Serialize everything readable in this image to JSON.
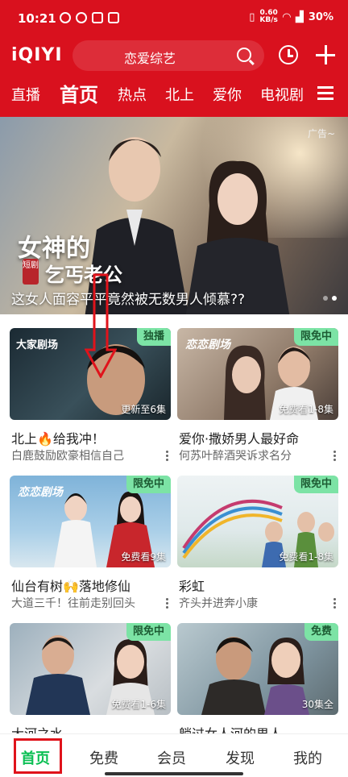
{
  "status_bar": {
    "time": "10:21",
    "net_speed_top": "0.60",
    "net_speed_unit": "KB/s",
    "battery": "30%"
  },
  "header": {
    "logo": "iQIYI",
    "search_text": "恋爱综艺"
  },
  "tabs": [
    "直播",
    "首页",
    "热点",
    "北上",
    "爱你",
    "电视剧"
  ],
  "active_tab": "首页",
  "banner": {
    "ad_label": "广告~",
    "title": "女神的",
    "short_badge": "短剧",
    "subtitle": "乞丐老公",
    "caption": "这女人面容平平竟然被无数男人倾慕??"
  },
  "cards": [
    {
      "title": "北上🔥给我冲！",
      "desc": "白鹿鼓励欧豪相信自己",
      "badge": "独播",
      "episode": "更新至6集",
      "brand": "大家剧场"
    },
    {
      "title": "爱你·撒娇男人最好命",
      "desc": "何苏叶醉酒哭诉求名分",
      "badge": "限免中",
      "episode": "免费看1-8集",
      "brand": "恋恋剧场"
    },
    {
      "title": "仙台有树🙌落地修仙",
      "desc": "大道三千！往前走别回头",
      "badge": "限免中",
      "episode": "免费看9集",
      "brand": "恋恋剧场"
    },
    {
      "title": "彩虹",
      "desc": "齐头并进奔小康",
      "badge": "限免中",
      "episode": "免费看1-8集",
      "brand": "彩虹"
    },
    {
      "title": "大河之水",
      "desc": "",
      "badge": "限免中",
      "episode": "免费看1-6集",
      "brand": ""
    },
    {
      "title": "躺过女人河的男人",
      "desc": "",
      "badge": "免费",
      "episode": "30集全",
      "brand": ""
    }
  ],
  "bottom_nav": [
    "首页",
    "免费",
    "会员",
    "发现",
    "我的"
  ],
  "colors": {
    "brand_red": "#d9111e",
    "badge_green": "#7ce3a5",
    "active_green": "#0abf53"
  }
}
